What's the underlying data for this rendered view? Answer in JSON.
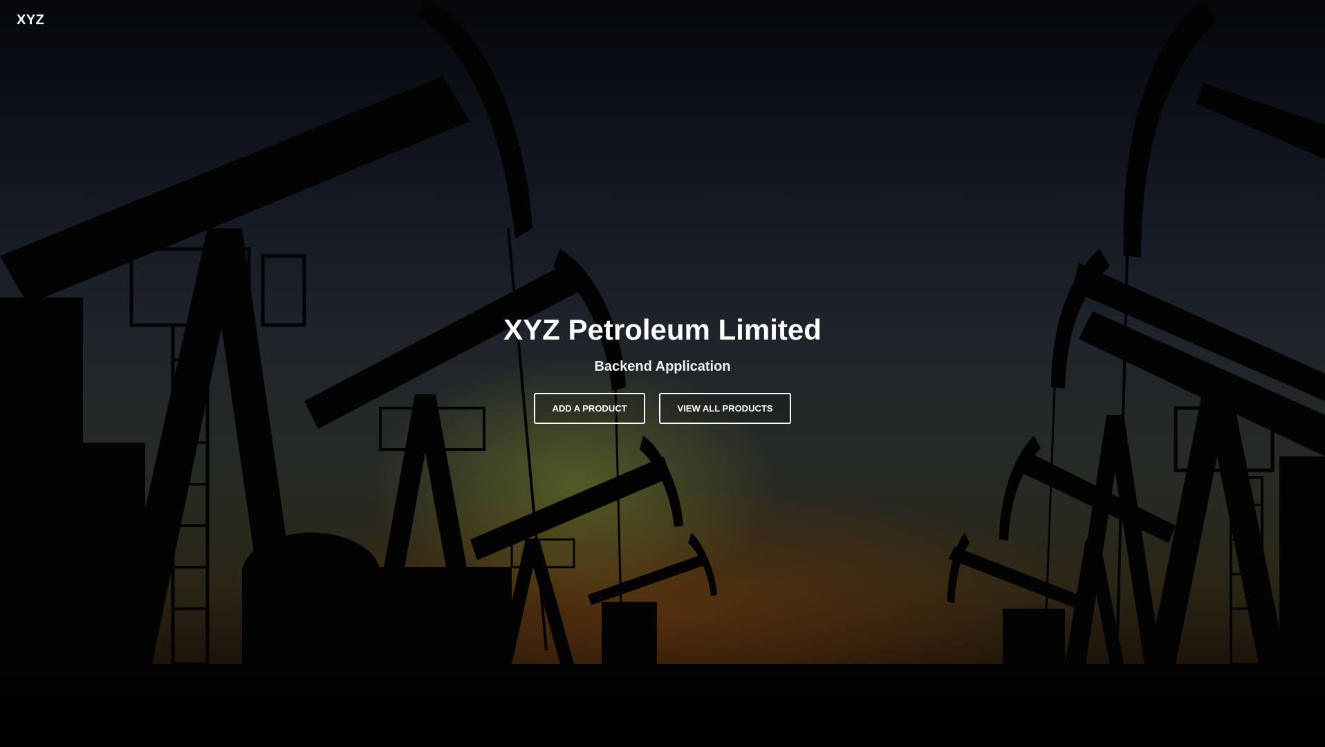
{
  "brand": {
    "label": "XYZ"
  },
  "hero": {
    "title": "XYZ Petroleum Limited",
    "subtitle": "Backend Application",
    "background_image": "oil-pumpjacks-silhouette-sunset"
  },
  "actions": {
    "add_product_label": "ADD A PRODUCT",
    "view_products_label": "VIEW ALL PRODUCTS"
  },
  "colors": {
    "text": "#ffffff",
    "button_border": "#ffffff",
    "sky_top": "#05070b",
    "horizon_glow": "#6e370a"
  }
}
